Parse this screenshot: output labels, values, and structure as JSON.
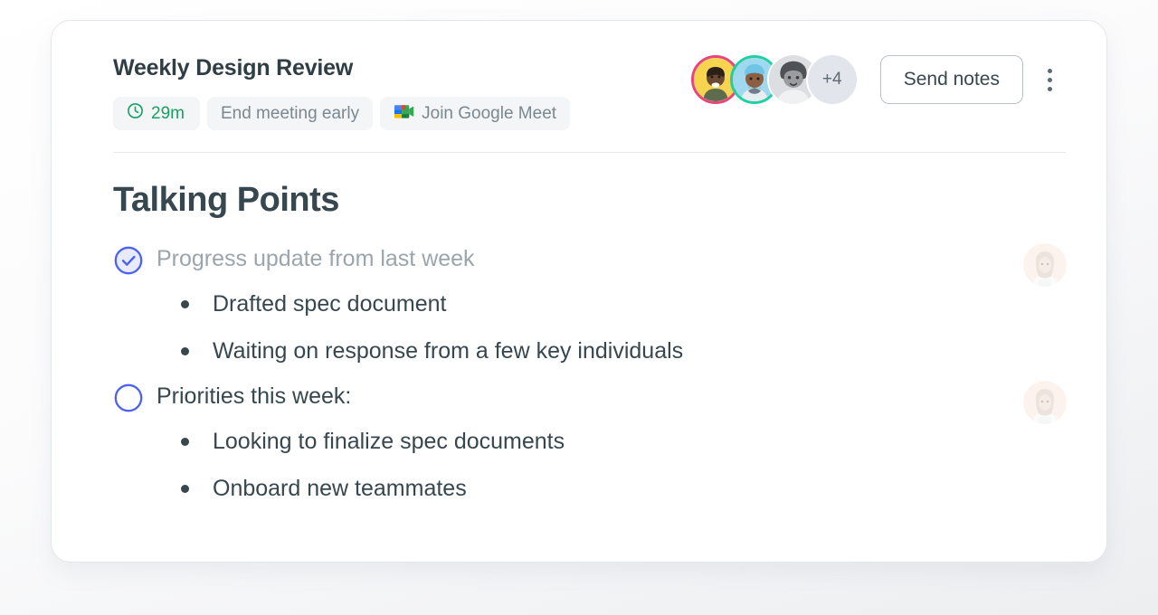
{
  "meeting": {
    "title": "Weekly Design Review",
    "chips": [
      {
        "id": "duration",
        "label": "29m",
        "icon": "clock-icon",
        "color": "#16a163"
      },
      {
        "id": "end-early",
        "label": "End meeting early",
        "icon": null,
        "color": "#7a8891"
      },
      {
        "id": "join-meet",
        "label": "Join Google Meet",
        "icon": "google-meet-icon",
        "color": "#7a8891"
      }
    ]
  },
  "participants": {
    "overflow_label": "+4",
    "avatars": [
      {
        "id": "avatar-1",
        "ring_color": "#e8457c",
        "bg_color": "#f6d44f",
        "style": "photo-color"
      },
      {
        "id": "avatar-2",
        "ring_color": "#23cfa2",
        "bg_color": "#9fd8ef",
        "style": "photo-color"
      },
      {
        "id": "avatar-3",
        "ring_color": null,
        "bg_color": "#d8dadd",
        "style": "photo-gray"
      }
    ]
  },
  "actions": {
    "send_notes_label": "Send notes",
    "more_menu_label": "More options"
  },
  "section": {
    "heading": "Talking Points"
  },
  "talking_points": [
    {
      "id": "point-1",
      "label": "Progress update from last week",
      "checked": true,
      "assignee_avatar": "woman-avatar",
      "sub_items": [
        "Drafted spec document",
        "Waiting on response from a few key individuals"
      ]
    },
    {
      "id": "point-2",
      "label": "Priorities this week:",
      "checked": false,
      "assignee_avatar": "woman-avatar",
      "sub_items": [
        "Looking to finalize spec documents",
        "Onboard new teammates"
      ]
    }
  ],
  "colors": {
    "accent_blue": "#4d61f4",
    "done_text": "#9aa5ad",
    "body_text": "#37474f",
    "chip_bg": "#f4f5f7",
    "green": "#16a163"
  }
}
